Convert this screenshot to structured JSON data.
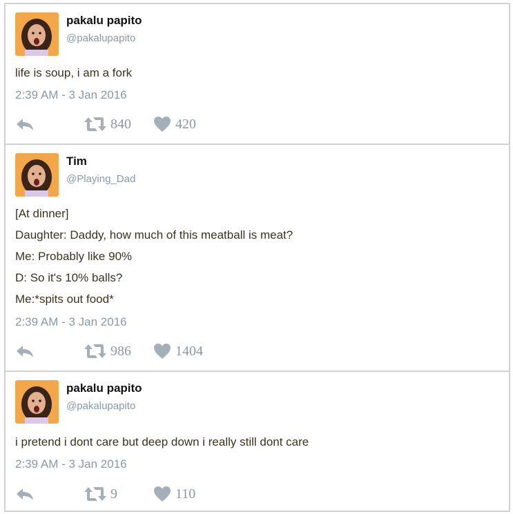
{
  "tweets": [
    {
      "name": "pakalu papito",
      "handle": "@pakalupapito",
      "lines": [
        "life is soup, i am a fork"
      ],
      "timestamp": "2:39 AM - 3 Jan 2016",
      "retweets": "840",
      "likes": "420"
    },
    {
      "name": "Tim",
      "handle": "@Playing_Dad",
      "lines": [
        "[At dinner]",
        "Daughter: Daddy, how much of this meatball is meat?",
        "Me: Probably like 90%",
        "D: So it's 10% balls?",
        "Me:*spits out food*"
      ],
      "timestamp": "2:39 AM - 3 Jan 2016",
      "retweets": "986",
      "likes": "1404"
    },
    {
      "name": "pakalu papito",
      "handle": "@pakalupapito",
      "lines": [
        "i pretend i dont care but deep down i really still dont care"
      ],
      "timestamp": "2:39 AM - 3 Jan 2016",
      "retweets": "9",
      "likes": "110"
    }
  ],
  "colors": {
    "border": "#cfd3d6",
    "muted": "#8899a6",
    "text": "#3b3320",
    "avatar_bg": "#f2a84a"
  },
  "icons": [
    "reply-icon",
    "retweet-icon",
    "heart-icon"
  ]
}
